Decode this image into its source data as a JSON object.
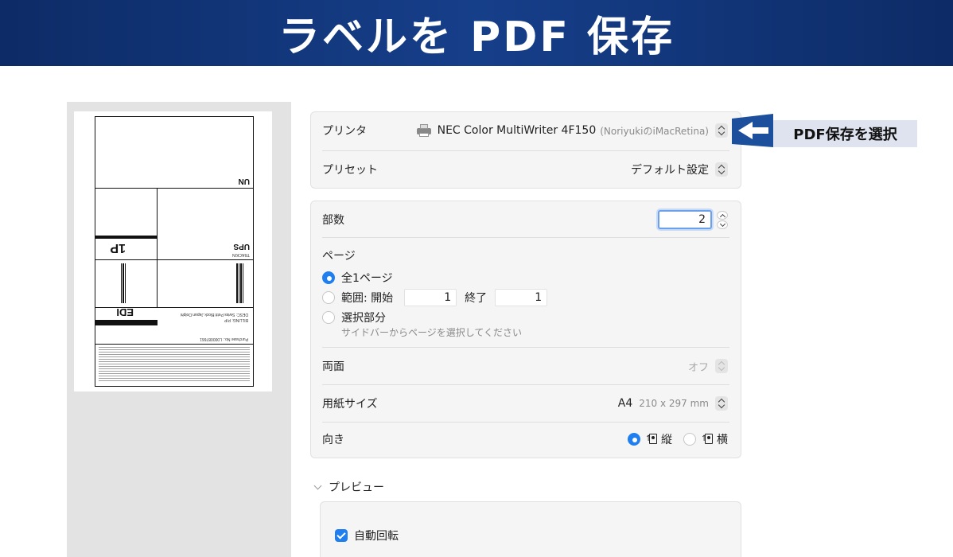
{
  "banner": {
    "title": "ラベルを PDF 保存"
  },
  "thumbnail": {
    "texts": {
      "edi": "EDI",
      "onep": "1P",
      "ups": "UPS",
      "tracking": "TRACKIN",
      "un": "UN",
      "purchase": "Purchase No.: L000087661",
      "billing": "BILLING: P/P",
      "desc": "DESC: Swiss Petit Block Japan Dolphi"
    }
  },
  "printer": {
    "label": "プリンタ",
    "name": "NEC Color MultiWriter 4F150",
    "host": "(NoriyukiのiMacRetina)"
  },
  "preset": {
    "label": "プリセット",
    "value": "デフォルト設定"
  },
  "copies": {
    "label": "部数",
    "value": "2"
  },
  "pages": {
    "title": "ページ",
    "all": "全1ページ",
    "range": "範囲: 開始",
    "range_start": "1",
    "range_end_label": "終了",
    "range_end": "1",
    "selection": "選択部分",
    "selection_hint": "サイドバーからページを選択してください"
  },
  "duplex": {
    "label": "両面",
    "value": "オフ"
  },
  "paper": {
    "label": "用紙サイズ",
    "size": "A4",
    "dims": "210 x 297 mm"
  },
  "orientation": {
    "label": "向き",
    "portrait": "縦",
    "landscape": "横"
  },
  "preview": {
    "label": "プレビュー",
    "auto_rotate": "自動回転"
  },
  "callout": {
    "text": "PDF保存を選択"
  },
  "colors": {
    "accent": "#1f7ff0",
    "banner": "#0d2b66",
    "callout_arrow": "#1c4f9c"
  }
}
